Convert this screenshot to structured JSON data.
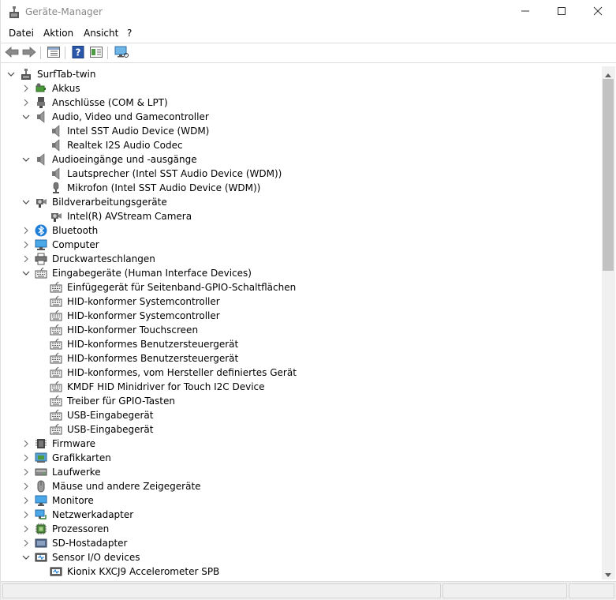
{
  "window": {
    "title": "Geräte-Manager",
    "minimize_icon": "minimize-icon",
    "maximize_icon": "maximize-icon",
    "close_icon": "close-icon"
  },
  "menu": {
    "items": [
      "Datei",
      "Aktion",
      "Ansicht",
      "?"
    ]
  },
  "toolbar": {
    "buttons": [
      "back-icon",
      "forward-icon",
      "properties-icon",
      "help-icon",
      "view-icon",
      "monitor-icon"
    ]
  },
  "tree": {
    "root": "SurfTab-twin",
    "nodes": [
      {
        "label": "Akkus",
        "level": 1,
        "state": "collapsed",
        "icon": "battery-icon"
      },
      {
        "label": "Anschlüsse (COM & LPT)",
        "level": 1,
        "state": "collapsed",
        "icon": "port-icon"
      },
      {
        "label": "Audio, Video und Gamecontroller",
        "level": 1,
        "state": "expanded",
        "icon": "speaker-icon"
      },
      {
        "label": "Intel SST Audio Device (WDM)",
        "level": 2,
        "state": "leaf",
        "icon": "speaker-icon"
      },
      {
        "label": "Realtek I2S Audio Codec",
        "level": 2,
        "state": "leaf",
        "icon": "speaker-icon"
      },
      {
        "label": "Audioeingänge und -ausgänge",
        "level": 1,
        "state": "expanded",
        "icon": "speaker-icon"
      },
      {
        "label": "Lautsprecher (Intel SST Audio Device (WDM))",
        "level": 2,
        "state": "leaf",
        "icon": "speaker-icon"
      },
      {
        "label": "Mikrofon (Intel SST Audio Device (WDM))",
        "level": 2,
        "state": "leaf",
        "icon": "microphone-icon"
      },
      {
        "label": "Bildverarbeitungsgeräte",
        "level": 1,
        "state": "expanded",
        "icon": "camera-icon"
      },
      {
        "label": "Intel(R) AVStream Camera",
        "level": 2,
        "state": "leaf",
        "icon": "camera-icon"
      },
      {
        "label": "Bluetooth",
        "level": 1,
        "state": "collapsed",
        "icon": "bluetooth-icon"
      },
      {
        "label": "Computer",
        "level": 1,
        "state": "collapsed",
        "icon": "computer-icon"
      },
      {
        "label": "Druckwarteschlangen",
        "level": 1,
        "state": "collapsed",
        "icon": "printer-icon"
      },
      {
        "label": "Eingabegeräte (Human Interface Devices)",
        "level": 1,
        "state": "expanded",
        "icon": "hid-icon"
      },
      {
        "label": "Einfügegerät für Seitenband-GPIO-Schaltflächen",
        "level": 2,
        "state": "leaf",
        "icon": "hid-icon"
      },
      {
        "label": "HID-konformer Systemcontroller",
        "level": 2,
        "state": "leaf",
        "icon": "hid-icon"
      },
      {
        "label": "HID-konformer Systemcontroller",
        "level": 2,
        "state": "leaf",
        "icon": "hid-icon"
      },
      {
        "label": "HID-konformer Touchscreen",
        "level": 2,
        "state": "leaf",
        "icon": "hid-icon"
      },
      {
        "label": "HID-konformes Benutzersteuergerät",
        "level": 2,
        "state": "leaf",
        "icon": "hid-icon"
      },
      {
        "label": "HID-konformes Benutzersteuergerät",
        "level": 2,
        "state": "leaf",
        "icon": "hid-icon"
      },
      {
        "label": "HID-konformes, vom Hersteller definiertes Gerät",
        "level": 2,
        "state": "leaf",
        "icon": "hid-icon"
      },
      {
        "label": "KMDF HID Minidriver for Touch I2C Device",
        "level": 2,
        "state": "leaf",
        "icon": "hid-icon"
      },
      {
        "label": "Treiber für GPIO-Tasten",
        "level": 2,
        "state": "leaf",
        "icon": "hid-icon"
      },
      {
        "label": "USB-Eingabegerät",
        "level": 2,
        "state": "leaf",
        "icon": "hid-icon"
      },
      {
        "label": "USB-Eingabegerät",
        "level": 2,
        "state": "leaf",
        "icon": "hid-icon"
      },
      {
        "label": "Firmware",
        "level": 1,
        "state": "collapsed",
        "icon": "firmware-icon"
      },
      {
        "label": "Grafikkarten",
        "level": 1,
        "state": "collapsed",
        "icon": "display-adapter-icon"
      },
      {
        "label": "Laufwerke",
        "level": 1,
        "state": "collapsed",
        "icon": "drive-icon"
      },
      {
        "label": "Mäuse und andere Zeigegeräte",
        "level": 1,
        "state": "collapsed",
        "icon": "mouse-icon"
      },
      {
        "label": "Monitore",
        "level": 1,
        "state": "collapsed",
        "icon": "monitor-icon"
      },
      {
        "label": "Netzwerkadapter",
        "level": 1,
        "state": "collapsed",
        "icon": "network-icon"
      },
      {
        "label": "Prozessoren",
        "level": 1,
        "state": "collapsed",
        "icon": "processor-icon"
      },
      {
        "label": "SD-Hostadapter",
        "level": 1,
        "state": "collapsed",
        "icon": "sd-host-icon"
      },
      {
        "label": "Sensor I/O devices",
        "level": 1,
        "state": "expanded",
        "icon": "sensor-icon"
      },
      {
        "label": "Kionix KXCJ9 Accelerometer SPB",
        "level": 2,
        "state": "leaf",
        "icon": "sensor-icon"
      }
    ]
  },
  "colors": {
    "scroll_track": "#f0f0f0",
    "scroll_thumb": "#c2c2c2",
    "status_bar": "#f0f0f0",
    "title_text": "#888888"
  }
}
